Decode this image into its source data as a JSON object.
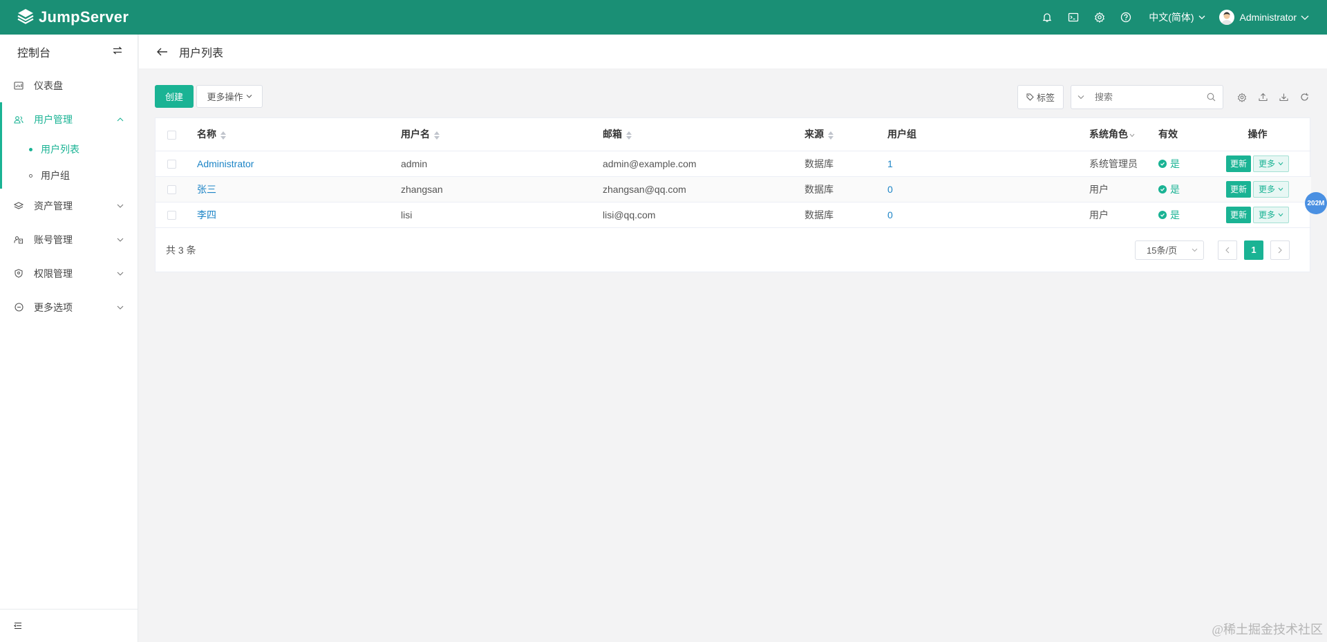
{
  "app": {
    "logo_text": "JumpServer",
    "language": "中文(简体)",
    "username": "Administrator",
    "brand_color": "#1a8f75",
    "accent_color": "#1ab394",
    "link_color": "#1c84c6"
  },
  "sidebar": {
    "title": "控制台",
    "items": [
      {
        "label": "仪表盘",
        "icon": "dashboard-icon"
      },
      {
        "label": "用户管理",
        "icon": "users-icon",
        "expanded": true
      },
      {
        "label": "资产管理",
        "icon": "layers-icon"
      },
      {
        "label": "账号管理",
        "icon": "account-icon"
      },
      {
        "label": "权限管理",
        "icon": "shield-icon"
      },
      {
        "label": "更多选项",
        "icon": "more-circle-icon"
      }
    ],
    "sub_items": [
      {
        "label": "用户列表",
        "active": true
      },
      {
        "label": "用户组",
        "active": false
      }
    ]
  },
  "page": {
    "title": "用户列表"
  },
  "toolbar": {
    "create_label": "创建",
    "more_actions_label": "更多操作",
    "tag_label": "标签",
    "search_placeholder": "搜索"
  },
  "table": {
    "headers": {
      "name": "名称",
      "username": "用户名",
      "email": "邮箱",
      "source": "来源",
      "groups": "用户组",
      "role": "系统角色",
      "valid": "有效",
      "actions": "操作"
    },
    "rows": [
      {
        "name": "Administrator",
        "username": "admin",
        "email": "admin@example.com",
        "source": "数据库",
        "groups": "1",
        "role": "系统管理员",
        "valid": "是"
      },
      {
        "name": "张三",
        "username": "zhangsan",
        "email": "zhangsan@qq.com",
        "source": "数据库",
        "groups": "0",
        "role": "用户",
        "valid": "是"
      },
      {
        "name": "李四",
        "username": "lisi",
        "email": "lisi@qq.com",
        "source": "数据库",
        "groups": "0",
        "role": "用户",
        "valid": "是"
      }
    ],
    "update_label": "更新",
    "more_label": "更多"
  },
  "pagination": {
    "total_text": "共 3 条",
    "page_size": "15条/页",
    "current_page": "1"
  },
  "float_badge": "202M",
  "watermark": "@稀土掘金技术社区"
}
